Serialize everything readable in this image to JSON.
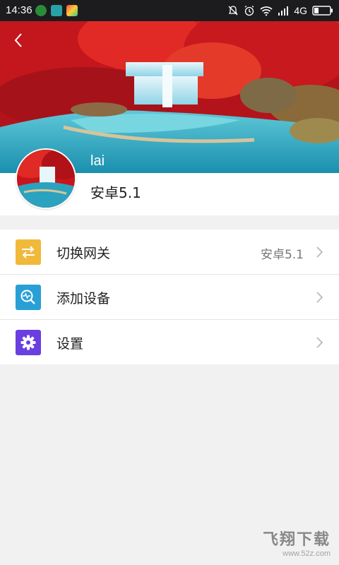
{
  "status_bar": {
    "time": "14:36",
    "network": "4G",
    "icons": [
      "notification-muted-icon",
      "alarm-icon",
      "wifi-icon",
      "signal-icon",
      "battery-icon"
    ]
  },
  "profile": {
    "name": "lai",
    "subtitle": "安卓5.1"
  },
  "menu": {
    "items": [
      {
        "label": "切换网关",
        "value": "安卓5.1",
        "icon": "swap-arrows-icon",
        "color": "#f0b93a"
      },
      {
        "label": "添加设备",
        "value": "",
        "icon": "device-scan-icon",
        "color": "#2a9fd6"
      },
      {
        "label": "设置",
        "value": "",
        "icon": "gear-icon",
        "color": "#6a3fe0"
      }
    ]
  },
  "watermark": {
    "title": "飞翔下载",
    "url": "www.52z.com"
  }
}
